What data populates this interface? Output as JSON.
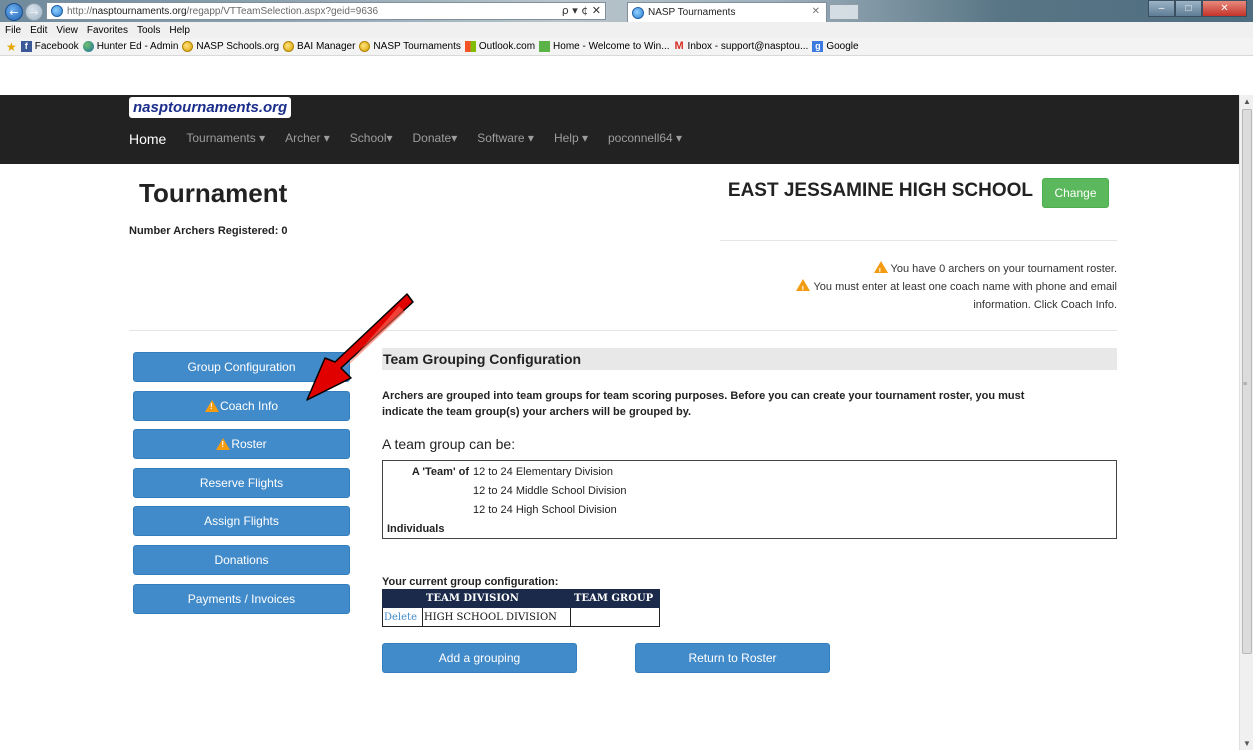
{
  "browser": {
    "url_prefix": "http://",
    "url_domain": "nasptournaments.org",
    "url_path": "/regapp/VTTeamSelection.aspx?geid=9636",
    "address_tools": "ρ ▾ ¢ ✕",
    "tab_title": "NASP Tournaments",
    "tab_close": "✕",
    "window_controls": [
      "–",
      "□",
      "✕"
    ],
    "chrome_icons": "⌂★⚙",
    "menu": [
      "File",
      "Edit",
      "View",
      "Favorites",
      "Tools",
      "Help"
    ],
    "favorites": [
      {
        "label": "Facebook",
        "icon": "facebook-icon"
      },
      {
        "label": "Hunter Ed - Admin",
        "icon": "globe-icon"
      },
      {
        "label": "NASP Schools.org",
        "icon": "ie-page-icon"
      },
      {
        "label": "BAI Manager",
        "icon": "ie-page-icon"
      },
      {
        "label": "NASP Tournaments",
        "icon": "ie-page-icon"
      },
      {
        "label": "Outlook.com",
        "icon": "outlook-icon"
      },
      {
        "label": "Home - Welcome to Win...",
        "icon": "windows-icon"
      },
      {
        "label": "Inbox - support@nasptou...",
        "icon": "gmail-icon"
      },
      {
        "label": "Google",
        "icon": "google-icon"
      }
    ]
  },
  "site": {
    "logo": "nasptournaments.org",
    "nav": {
      "home": "Home",
      "tournaments": "Tournaments ▾",
      "archer": "Archer ▾",
      "school": "School▾",
      "donate": "Donate▾",
      "software": "Software ▾",
      "help": "Help ▾",
      "user": "poconnell64 ▾"
    }
  },
  "header": {
    "title": "Tournament",
    "archers_registered": "Number Archers Registered: 0",
    "school_name": "EAST JESSAMINE HIGH SCHOOL",
    "change_label": "Change"
  },
  "warnings": {
    "roster": "You have 0 archers on your tournament roster.",
    "coach_line1": "You must enter at least one coach name with phone and email",
    "coach_line2": "information. Click Coach Info."
  },
  "sidebar": {
    "group_configuration": "Group Configuration",
    "coach_info": "Coach Info",
    "roster": "Roster",
    "reserve_flights": "Reserve Flights",
    "assign_flights": "Assign Flights",
    "donations": "Donations",
    "payments_invoices": "Payments / Invoices"
  },
  "main": {
    "heading": "Team Grouping Configuration",
    "intro_line1": "Archers are grouped into team groups for team scoring purposes. Before you can create your tournament roster, you must",
    "intro_line2": "indicate the team group(s) your archers will be grouped by.",
    "team_group_heading": "A team group can be:",
    "team_label": "A 'Team' of",
    "team_options": [
      "12 to 24 Elementary Division",
      "12 to 24 Middle School Division",
      "12 to 24 High School Division"
    ],
    "individuals": "Individuals",
    "current_config_label": "Your current group configuration:",
    "table_headers": [
      "",
      "TEAM DIVISION",
      "TEAM GROUP"
    ],
    "table_rows": [
      {
        "action": "Delete",
        "division": "HIGH SCHOOL DIVISION",
        "group": ""
      }
    ],
    "add_grouping": "Add a grouping",
    "return_to_roster": "Return to Roster"
  },
  "colors": {
    "primary_button": "#428bca",
    "success_button": "#5cb85c",
    "navbar": "#222222",
    "warning": "#f39c12",
    "annotation_arrow": "#e00000"
  }
}
